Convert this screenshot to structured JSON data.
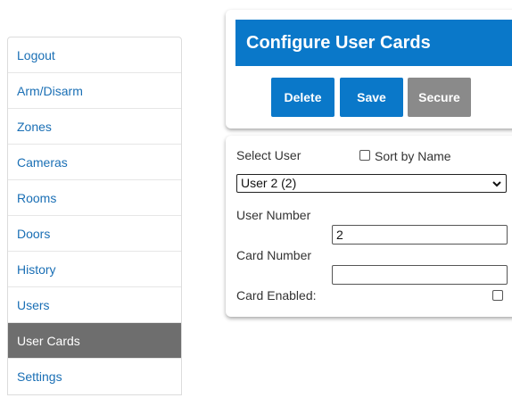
{
  "sidebar": {
    "items": [
      {
        "label": "Logout"
      },
      {
        "label": "Arm/Disarm"
      },
      {
        "label": "Zones"
      },
      {
        "label": "Cameras"
      },
      {
        "label": "Rooms"
      },
      {
        "label": "Doors"
      },
      {
        "label": "History"
      },
      {
        "label": "Users"
      },
      {
        "label": "User Cards",
        "active": true
      },
      {
        "label": "Settings"
      }
    ]
  },
  "header": {
    "title": "Configure User Cards",
    "buttons": {
      "delete": "Delete",
      "save": "Save",
      "secure": "Secure"
    }
  },
  "form": {
    "select_user_label": "Select User",
    "sort_by_name_label": "Sort by Name",
    "sort_by_name_checked": false,
    "user_select_value": "User 2 (2)",
    "user_number_label": "User Number",
    "user_number_value": "2",
    "card_number_label": "Card Number",
    "card_number_value": "",
    "card_enabled_label": "Card Enabled:",
    "card_enabled_checked": false
  },
  "colors": {
    "accent": "#0a78c9",
    "link": "#1a6fb5",
    "active_item": "#6e6e6e",
    "disabled_button": "#8a8a8a"
  }
}
